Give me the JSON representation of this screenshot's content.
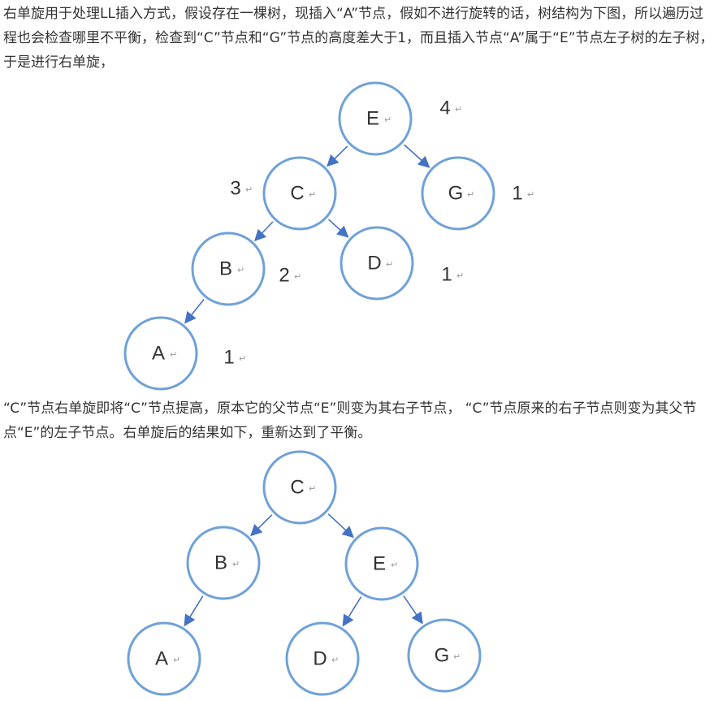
{
  "text": {
    "paragraph1": "右单旋用于处理LL插入方式，假设存在一棵树，现插入“A”节点，假如不进行旋转的话，树结构为下图，所以遍历过程也会检查哪里不平衡，检查到“C”节点和“G”节点的高度差大于1，而且插入节点“A”属于“E”节点左子树的左子树，于是进行右单旋，",
    "paragraph2": "“C”节点右单旋即将“C”节点提高，原本它的父节点“E”则变为其右子节点， “C”节点原来的右子节点则变为其父节点“E”的左子节点。右单旋后的结果如下，重新达到了平衡。"
  },
  "paragraph_mark": "↵",
  "tree_before": {
    "nodes": [
      {
        "id": "E",
        "label": "E",
        "height": "4"
      },
      {
        "id": "C",
        "label": "C",
        "height": "3"
      },
      {
        "id": "G",
        "label": "G",
        "height": "1"
      },
      {
        "id": "B",
        "label": "B",
        "height": "2"
      },
      {
        "id": "D",
        "label": "D",
        "height": "1"
      },
      {
        "id": "A",
        "label": "A",
        "height": "1"
      }
    ],
    "edges": [
      [
        "E",
        "C"
      ],
      [
        "E",
        "G"
      ],
      [
        "C",
        "B"
      ],
      [
        "C",
        "D"
      ],
      [
        "B",
        "A"
      ]
    ]
  },
  "tree_after": {
    "nodes": [
      {
        "id": "C",
        "label": "C"
      },
      {
        "id": "B",
        "label": "B"
      },
      {
        "id": "E",
        "label": "E"
      },
      {
        "id": "A",
        "label": "A"
      },
      {
        "id": "D",
        "label": "D"
      },
      {
        "id": "G",
        "label": "G"
      }
    ],
    "edges": [
      [
        "C",
        "B"
      ],
      [
        "C",
        "E"
      ],
      [
        "B",
        "A"
      ],
      [
        "E",
        "D"
      ],
      [
        "E",
        "G"
      ]
    ]
  },
  "colors": {
    "node_stroke": "#6fa1d9",
    "edge": "#4472c4",
    "text": "#333333"
  }
}
